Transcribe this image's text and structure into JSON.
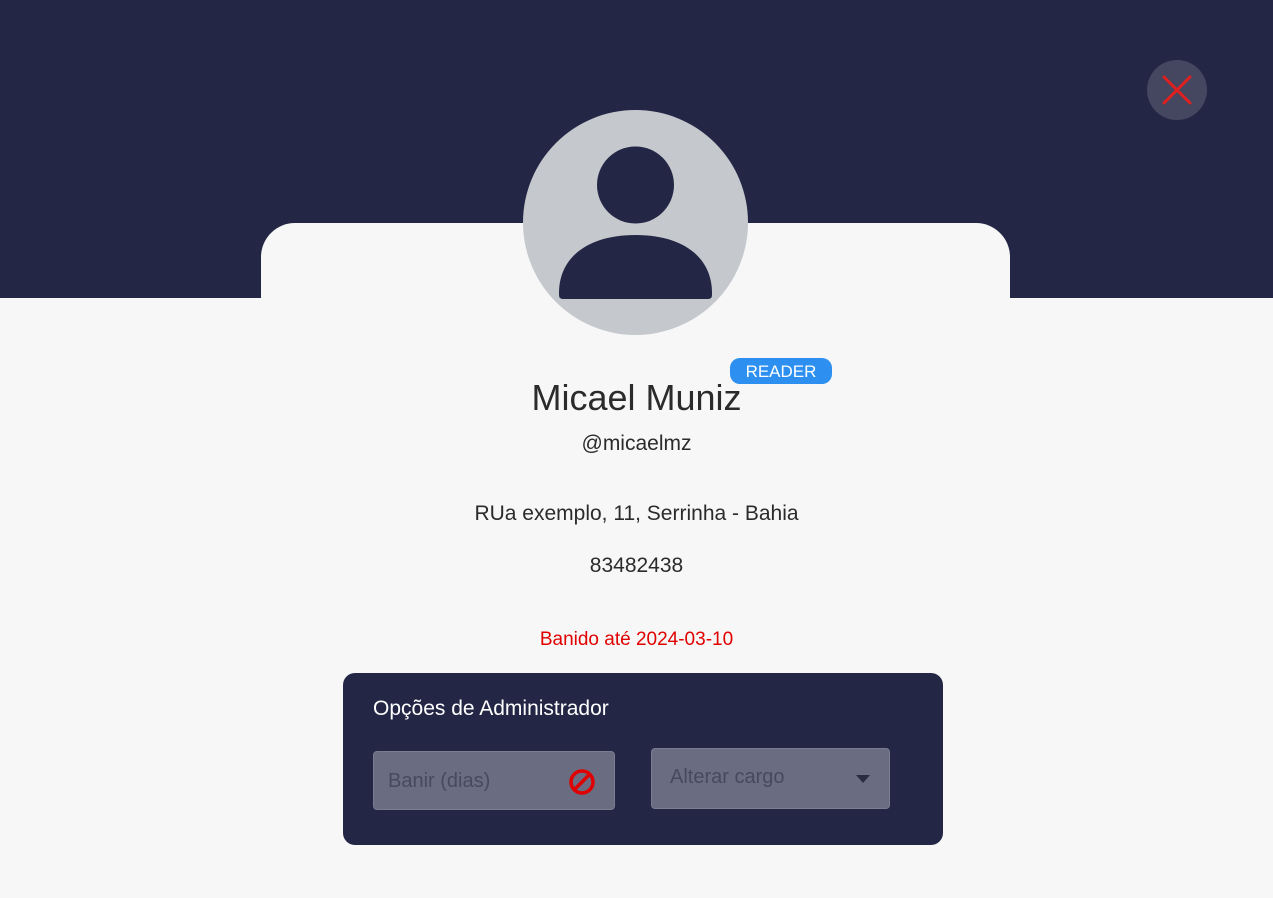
{
  "profile": {
    "name": "Micael Muniz",
    "role_badge": "READER",
    "username": "@micaelmz",
    "address": "RUa exemplo, 11, Serrinha - Bahia",
    "phone": "83482438",
    "ban_status": "Banido até 2024-03-10"
  },
  "admin": {
    "title": "Opções de Administrador",
    "ban_placeholder": "Banir (dias)",
    "role_select_label": "Alterar cargo"
  },
  "icons": {
    "close": "close-icon",
    "avatar": "user-avatar-icon",
    "ban": "ban-icon",
    "dropdown": "chevron-down-icon"
  },
  "colors": {
    "header": "#232745",
    "badge": "#2d8ff0",
    "ban_text": "#e00000",
    "close_x": "#e02020"
  }
}
